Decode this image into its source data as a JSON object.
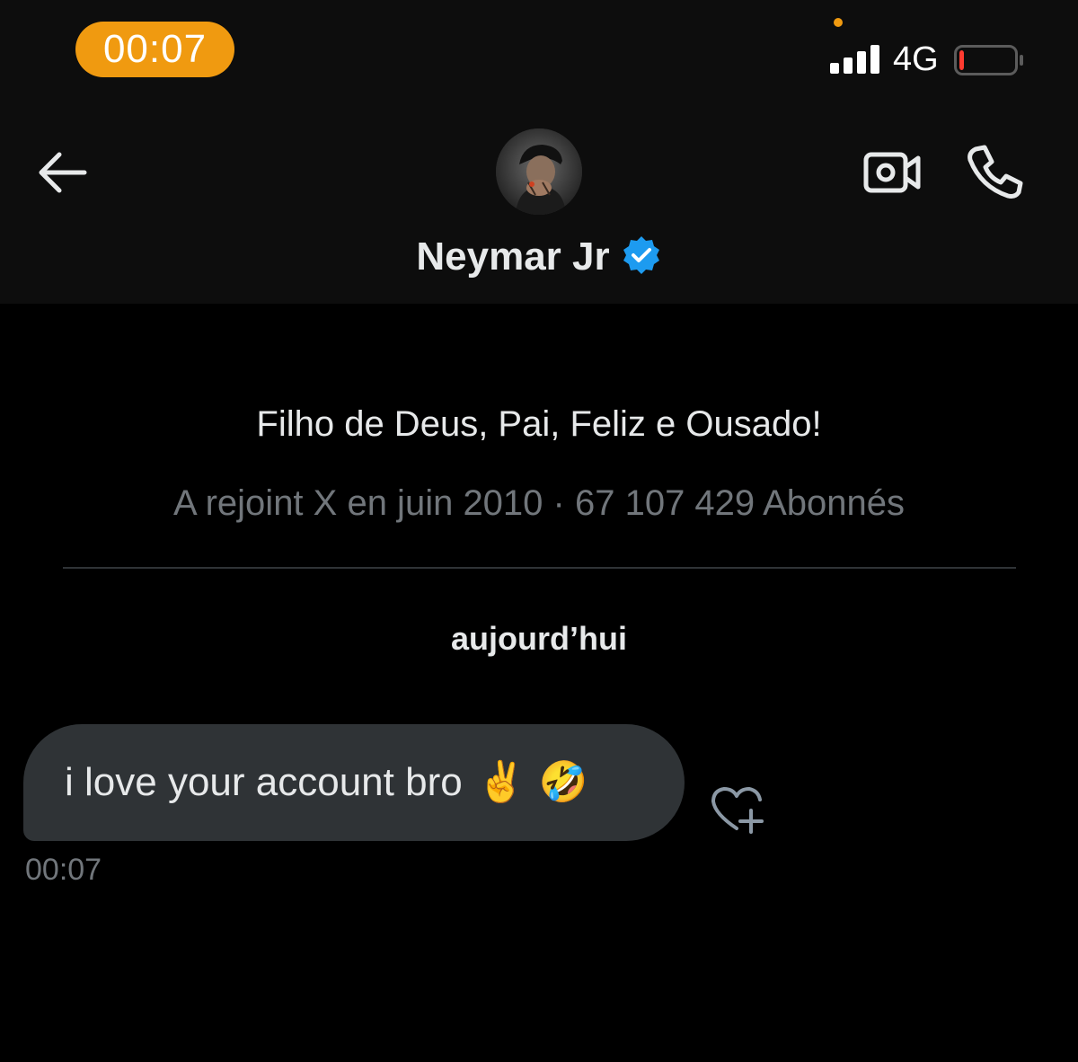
{
  "status_bar": {
    "time": "00:07",
    "network": "4G",
    "pill_color": "#f09a10",
    "mic_indicator_color": "#f09a10",
    "battery_level_color": "#ff3b30",
    "battery_level": 0.08
  },
  "nav": {
    "back_icon": "arrow-left-icon",
    "video_icon": "video-call-icon",
    "phone_icon": "phone-icon"
  },
  "profile": {
    "name": "Neymar Jr",
    "verified_color": "#1d9bf0",
    "bio": "Filho de Deus, Pai, Feliz e Ousado!",
    "meta": "A rejoint X en juin 2010 · 67 107 429 Abonnés"
  },
  "conversation": {
    "day_label": "aujourd’hui",
    "messages": [
      {
        "text": "i love your account bro",
        "emojis": "✌️ 🤣",
        "time": "00:07",
        "react_icon": "heart-plus-icon"
      }
    ]
  }
}
